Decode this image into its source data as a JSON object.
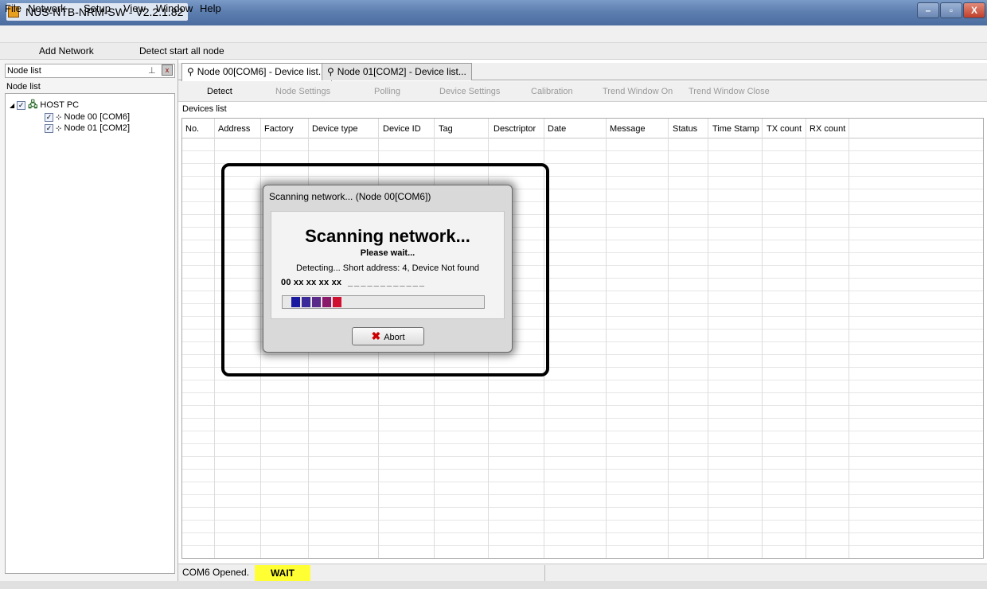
{
  "window": {
    "title": "NUS-NTB-NRM-SW - V2.2.1.82",
    "controls": [
      "–",
      "▫",
      "X"
    ]
  },
  "menu": {
    "items": [
      {
        "label": "File",
        "key": "F"
      },
      {
        "label": "Network",
        "key": "N"
      },
      {
        "label": "Setup",
        "key": "S"
      },
      {
        "label": "View",
        "key": "V"
      },
      {
        "label": "Window",
        "key": "W"
      },
      {
        "label": "Help",
        "key": "H"
      }
    ]
  },
  "toolbar": {
    "add_network": "Add Network",
    "detect_all": "Detect start all node"
  },
  "left_panel": {
    "header": "Node list",
    "pin_glyph": "⊥",
    "close_glyph": "x",
    "section_label": "Node list",
    "tree": {
      "root": "HOST PC",
      "children": [
        "Node 00 [COM6]",
        "Node 01 [COM2]"
      ]
    }
  },
  "tabs": [
    {
      "label": "Node 00[COM6] - Device list...",
      "active": true
    },
    {
      "label": "Node 01[COM2] - Device list...",
      "active": false
    }
  ],
  "subtoolbar": {
    "items": [
      {
        "label": "Detect",
        "enabled": true
      },
      {
        "label": "Node Settings",
        "enabled": false
      },
      {
        "label": "Polling",
        "enabled": false
      },
      {
        "label": "Device Settings",
        "enabled": false
      },
      {
        "label": "Calibration",
        "enabled": false
      },
      {
        "label": "Trend Window On",
        "enabled": false
      },
      {
        "label": "Trend Window Close",
        "enabled": false
      }
    ]
  },
  "devices": {
    "label": "Devices list",
    "columns": [
      "No.",
      "Address",
      "Factory",
      "Device type",
      "Device ID",
      "Tag",
      "Desctriptor",
      "Date",
      "Message",
      "Status",
      "Time Stamp",
      "TX count",
      "RX count"
    ]
  },
  "status": {
    "text": "COM6 Opened.",
    "badge": "WAIT",
    "badge_color": "#ffff33"
  },
  "dialog": {
    "title": "Scanning network... (Node 00[COM6])",
    "heading": "Scanning network...",
    "subheading": "Please wait...",
    "detecting": "Detecting...  Short address: 4, Device Not found",
    "address_prefix": "00 xx xx xx xx",
    "address_rest": "_ _ _ _ _ _ _ _ _ _ _ _",
    "progress_segments": 5,
    "progress_colors": [
      "#1a1aa0",
      "#3a2a9a",
      "#5a2a8a",
      "#8a1a6a",
      "#d01030"
    ],
    "abort_label": "Abort"
  }
}
